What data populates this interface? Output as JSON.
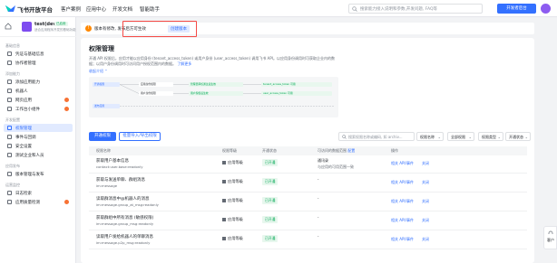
{
  "topbar": {
    "brand": "飞书开放平台",
    "nav": [
      "客户案例",
      "应用中心",
      "开发文档",
      "智能助手"
    ],
    "search_placeholder": "搜索能力接入说明和参数,开发问题, FAQ等",
    "dev_button": "开发者后台"
  },
  "app": {
    "name": "test(dev)",
    "badge": "已启用",
    "subtitle": "适合应用程序开发的基础功能"
  },
  "sidebar": {
    "groups": [
      {
        "title": "基础信息",
        "items": [
          {
            "label": "凭证与基础信息"
          },
          {
            "label": "协作者管理"
          }
        ]
      },
      {
        "title": "添加能力",
        "items": [
          {
            "label": "添加应用能力"
          },
          {
            "label": "机器人"
          },
          {
            "label": "网页应用",
            "dot": true
          },
          {
            "label": "工作台小组件",
            "dot": true
          }
        ]
      },
      {
        "title": "开发配置",
        "items": [
          {
            "label": "权限管理",
            "active": true
          },
          {
            "label": "事件与回调"
          },
          {
            "label": "安全设置"
          },
          {
            "label": "测试企业和人员"
          }
        ]
      },
      {
        "title": "应用发布",
        "items": [
          {
            "label": "版本管理与发布"
          }
        ]
      },
      {
        "title": "运营监控",
        "items": [
          {
            "label": "日志检索"
          },
          {
            "label": "应用质量检测",
            "dot": true
          }
        ]
      }
    ]
  },
  "notice": {
    "text": "版本有修改, 发布后方可生效",
    "link": "创建版本"
  },
  "permission": {
    "title": "权限管理",
    "desc": "开通 API 权限后，应用才能以应用身份 (tenant_access_token) 或用户身份 (user_access_token) 调用飞书 API。以应用身份调用时可获取企业内的数据；以用户身份调用时可访问用户授权范围内的数据。",
    "desc_link": "了解更多",
    "more": "收起介绍",
    "flow": {
      "step1": "开通权限",
      "step2": "发布应用",
      "boxes": [
        "应用身份权限",
        "用户身份权限",
        "管理员审核通过后生效",
        "用户授权后生效",
        "tenant_access_token 可用",
        "user_access_token 可用"
      ]
    },
    "buttons": {
      "open": "开通权限",
      "batch": "批量导入/导出权限"
    },
    "filter": {
      "search_placeholder": "搜索权限名称或编码, 如 archiv...",
      "selects": [
        "权限名称",
        "全部权限",
        "权限类型",
        "开通状态"
      ]
    },
    "columns": [
      "权限名称",
      "权限等级",
      "开通状态",
      "可访问的数据范围",
      "操作"
    ],
    "columns_extra": "配置",
    "rows": [
      {
        "name": "获取用户基本信息",
        "code": "contact:user.base:readonly",
        "level": "应用等级",
        "status": "已开通",
        "range": "通讯录",
        "range2": "与应用的可用范围一致",
        "actions": [
          "相关 API/事件",
          "关闭"
        ]
      },
      {
        "name": "获取与发送单聊、群组消息",
        "code": "im:message",
        "level": "应用等级",
        "status": "已开通",
        "range": "-",
        "range2": "",
        "actions": [
          "相关 API/事件",
          "关闭"
        ]
      },
      {
        "name": "读取群消息中@机器人的消息",
        "code": "im:message.group_at_msg:readonly",
        "level": "应用等级",
        "status": "已开通",
        "range": "-",
        "range2": "",
        "actions": [
          "相关 API/事件",
          "关闭"
        ]
      },
      {
        "name": "获取群组中所有消息 (敏感权限)",
        "code": "im:message.group_msg:readonly",
        "level": "应用等级",
        "status": "已开通",
        "range": "-",
        "range2": "",
        "actions": [
          "相关 API/事件",
          "关闭"
        ]
      },
      {
        "name": "读取用户发给机器人的单聊消息",
        "code": "im:message.p2p_msg:readonly",
        "level": "应用等级",
        "status": "已开通",
        "range": "-",
        "range2": "",
        "actions": [
          "相关 API/事件",
          "关闭"
        ]
      }
    ]
  },
  "sidetab": "客户"
}
